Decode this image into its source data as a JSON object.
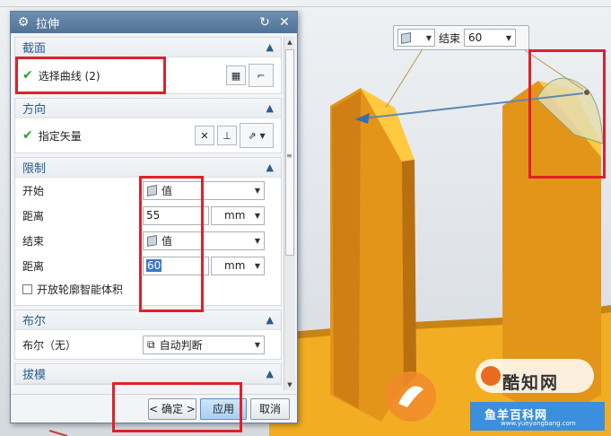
{
  "dialog": {
    "title": "拉伸",
    "sections": {
      "section": {
        "title": "截面",
        "select_curve_label": "选择曲线 (2)"
      },
      "direction": {
        "title": "方向",
        "specify_vector_label": "指定矢量"
      },
      "limits": {
        "title": "限制",
        "start_label": "开始",
        "start_option": "值",
        "start_distance_label": "距离",
        "start_distance_value": "55",
        "start_unit": "mm",
        "end_label": "结束",
        "end_option": "值",
        "end_distance_label": "距离",
        "end_distance_value": "60",
        "end_unit": "mm",
        "open_profile_label": "开放轮廓智能体积"
      },
      "boolean": {
        "title": "布尔",
        "boolean_label": "布尔（无）",
        "boolean_option": "自动判断"
      },
      "draft": {
        "title": "拔模"
      }
    },
    "buttons": {
      "ok": "< 确定 >",
      "apply": "应用",
      "cancel": "取消"
    }
  },
  "viewport": {
    "float_box": {
      "end_label": "结束",
      "end_value": "60"
    }
  },
  "watermark": {
    "brand": "酷知网",
    "site": "鱼羊百科网",
    "url": "www.yueyangbang.com"
  },
  "colors": {
    "part_orange": "#f0a41f",
    "part_light": "#ffc940",
    "highlight_red": "#e0202a",
    "title_blue": "#4f7396",
    "section_blue": "#2b5c8a"
  }
}
